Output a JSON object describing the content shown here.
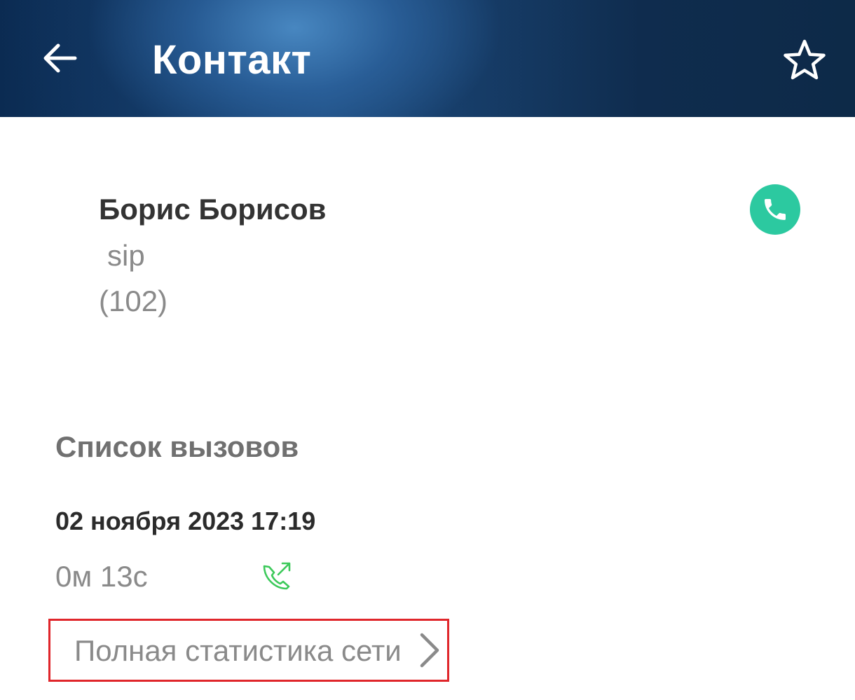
{
  "header": {
    "title": "Контакт",
    "back_icon": "arrow-left-icon",
    "favorite_icon": "star-outline-icon"
  },
  "contact": {
    "name": "Борис Борисов",
    "type": "sip",
    "number": "(102)",
    "call_icon": "phone-icon",
    "call_button_color": "#2cc9a0"
  },
  "calls": {
    "section_title": "Список вызовов",
    "items": [
      {
        "datetime": "02 ноября 2023 17:19",
        "duration": "0м 13с",
        "direction_icon": "outgoing-call-icon",
        "direction_color": "#3cc95a"
      }
    ]
  },
  "stats_link": {
    "label": "Полная статистика сети",
    "chevron_icon": "chevron-right-icon",
    "highlight_color": "#e0262b"
  }
}
